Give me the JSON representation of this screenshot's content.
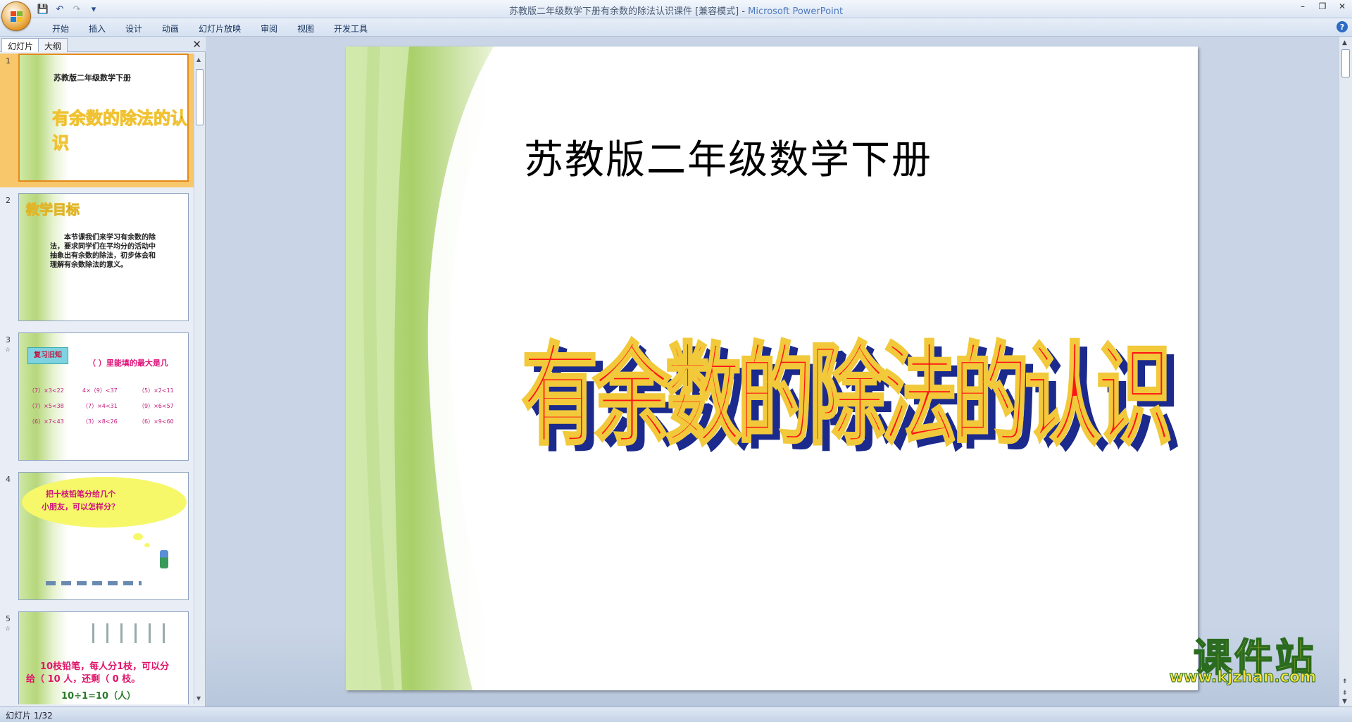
{
  "window": {
    "title": "苏教版二年级数学下册有余数的除法认识课件 [兼容模式] - ",
    "app_name": "Microsoft PowerPoint"
  },
  "quick_access": {
    "save": "💾",
    "undo": "↶",
    "redo": "↷",
    "customize": "▾"
  },
  "window_controls": {
    "minimize": "–",
    "restore": "❐",
    "close": "✕"
  },
  "ribbon": {
    "tabs": [
      "开始",
      "插入",
      "设计",
      "动画",
      "幻灯片放映",
      "审阅",
      "视图",
      "开发工具"
    ],
    "help": "?"
  },
  "left_pane": {
    "tabs": [
      "幻灯片",
      "大纲"
    ],
    "close": "✕",
    "slides": [
      {
        "num": "1",
        "star": "",
        "subtitle": "苏教版二年级数学下册",
        "title": "有余数的除法的认识"
      },
      {
        "num": "2",
        "star": "",
        "heading": "教学目标",
        "body": "本节课我们来学习有余数的除法，要求同学们在平均分的活动中抽象出有余数的除法，初步体会和理解有余数除法的意义。"
      },
      {
        "num": "3",
        "star": "☆",
        "tag": "复习旧知",
        "question": "（ ）里能填的最大是几",
        "rows": [
          [
            "（7）×3<22",
            "4×（9）<37",
            "（5）×2<11"
          ],
          [
            "（7）×5<38",
            "（7）×4<31",
            "（9）×6<57"
          ],
          [
            "（6）×7<43",
            "（3）×8<26",
            "（6）×9<60"
          ]
        ]
      },
      {
        "num": "4",
        "star": "",
        "bubble_line1": "把十枝铅笔分给几个",
        "bubble_line2": "小朋友，可以怎样分？"
      },
      {
        "num": "5",
        "star": "☆",
        "line1": "10枝铅笔，每人分1枝，可以分",
        "line2": "给（ 10 人，还剩（ 0 枝。",
        "line3": "10÷1=10（人）"
      }
    ]
  },
  "slide": {
    "subtitle": "苏教版二年级数学下册",
    "title": "有余数的除法的认识"
  },
  "status": {
    "text": "幻灯片 1/32"
  },
  "watermark": {
    "title": "课件站",
    "url": "www.kjzhan.com"
  }
}
